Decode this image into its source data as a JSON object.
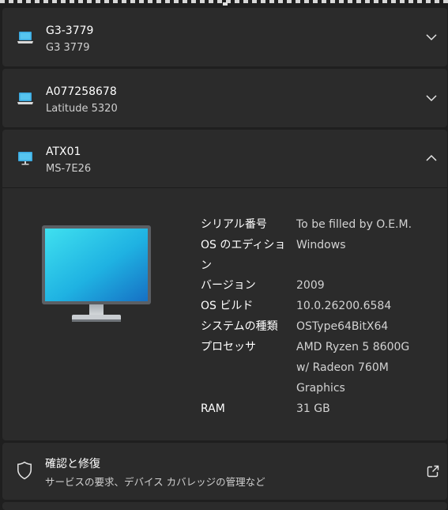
{
  "devices": [
    {
      "name": "G3-3779",
      "model": "G3 3779",
      "icon": "laptop-icon",
      "expanded": false
    },
    {
      "name": "A077258678",
      "model": "Latitude 5320",
      "icon": "laptop-icon",
      "expanded": false
    },
    {
      "name": "ATX01",
      "model": "MS-7E26",
      "icon": "desktop-monitor-icon",
      "expanded": true
    }
  ],
  "specs": [
    {
      "label": "シリアル番号",
      "value": "To be filled by O.E.M."
    },
    {
      "label": "OS のエディショ",
      "value": "Windows"
    },
    {
      "label": "ン",
      "value": ""
    },
    {
      "label": "バージョン",
      "value": "2009"
    },
    {
      "label": "OS ビルド",
      "value": "10.0.26200.6584"
    },
    {
      "label": "システムの種類",
      "value": "OSType64BitX64"
    },
    {
      "label": "プロセッサ",
      "value": "AMD Ryzen 5 8600G"
    },
    {
      "label": "",
      "value": "w/ Radeon 760M"
    },
    {
      "label": "",
      "value": "Graphics"
    },
    {
      "label": "RAM",
      "value": "31 GB"
    }
  ],
  "repair": {
    "title": "確認と修復",
    "subtitle": "サービスの要求、デバイス カバレッジの管理など",
    "icon": "shield-icon",
    "action_icon": "open-external-icon"
  },
  "colors": {
    "background": "#1f1f1f",
    "card": "#2b2b2b",
    "text": "#ffffff",
    "secondary_text": "#cfcfcf",
    "accent": "#2aa3df"
  }
}
